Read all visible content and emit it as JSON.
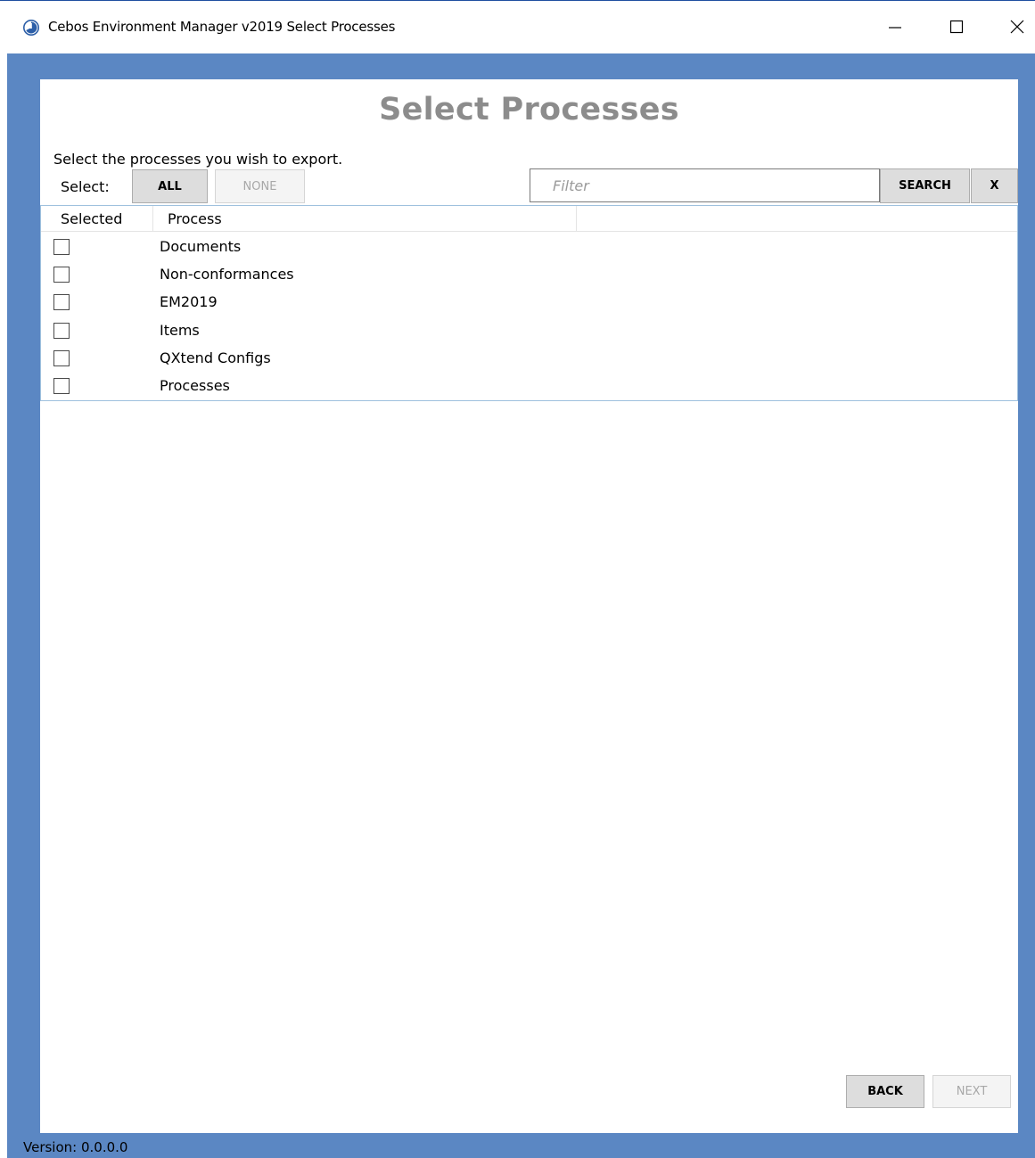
{
  "window": {
    "title": "Cebos Environment Manager v2019 Select Processes",
    "app_icon": "cebos-logo-icon",
    "controls": {
      "minimize_icon": "minimize-icon",
      "maximize_icon": "maximize-icon",
      "close_icon": "close-icon"
    }
  },
  "page": {
    "title": "Select Processes",
    "instruction": "Select the processes you wish to export."
  },
  "select_bar": {
    "label": "Select:",
    "all_label": "ALL",
    "none_label": "NONE",
    "none_disabled": true
  },
  "filter": {
    "value": "",
    "placeholder": "Filter",
    "search_label": "SEARCH",
    "clear_label": "X"
  },
  "grid": {
    "columns": [
      "Selected",
      "Process"
    ],
    "rows": [
      {
        "selected": false,
        "process": "Documents"
      },
      {
        "selected": false,
        "process": "Non-conformances"
      },
      {
        "selected": false,
        "process": "EM2019"
      },
      {
        "selected": false,
        "process": "Items"
      },
      {
        "selected": false,
        "process": "QXtend Configs"
      },
      {
        "selected": false,
        "process": "Processes"
      }
    ]
  },
  "navigation": {
    "back_label": "BACK",
    "next_label": "NEXT",
    "next_disabled": true
  },
  "footer": {
    "version": "Version: 0.0.0.0"
  },
  "colors": {
    "frame_blue": "#5b87c3",
    "title_gray": "#8c8c8c",
    "grid_border": "#9fc1de"
  }
}
